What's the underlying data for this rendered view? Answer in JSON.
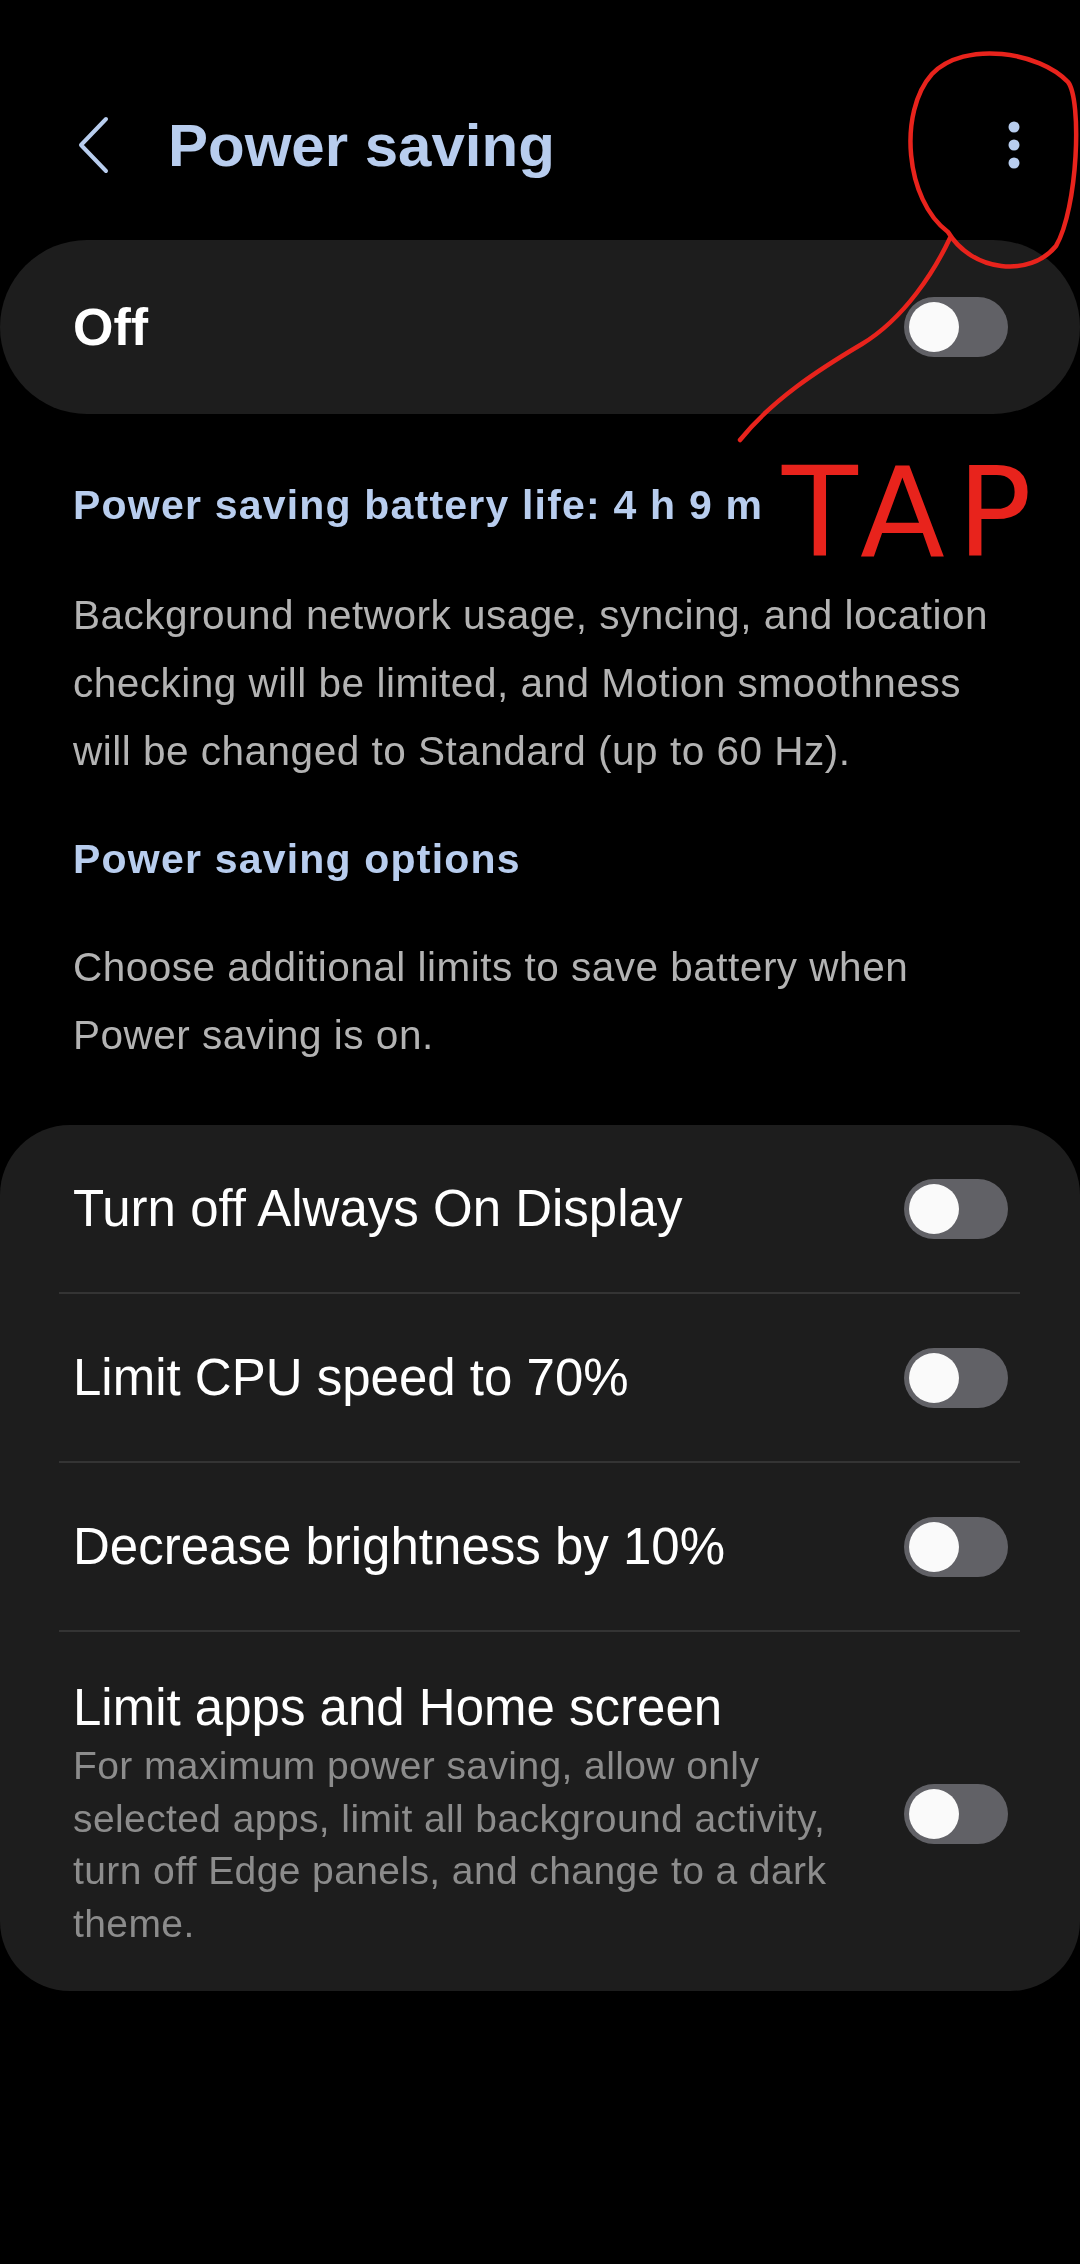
{
  "header": {
    "title": "Power saving"
  },
  "master_switch": {
    "label": "Off",
    "on": false
  },
  "battery_life": "Power saving battery life: 4 h 9 m",
  "description": "Background network usage, syncing, and location checking will be limited, and Motion smoothness will be changed to Standard (up to 60 Hz).",
  "options_section": {
    "heading": "Power saving options",
    "description": "Choose additional limits to save battery when Power saving is on."
  },
  "options": [
    {
      "title": "Turn off Always On Display",
      "on": false
    },
    {
      "title": "Limit CPU speed to 70%",
      "on": false
    },
    {
      "title": "Decrease brightness by 10%",
      "on": false
    },
    {
      "title": "Limit apps and Home screen",
      "subtitle": "For maximum power saving, allow only selected apps, limit all background activity, turn off Edge panels, and change to a dark theme.",
      "on": false
    }
  ],
  "annotation": {
    "text": "TAP"
  }
}
